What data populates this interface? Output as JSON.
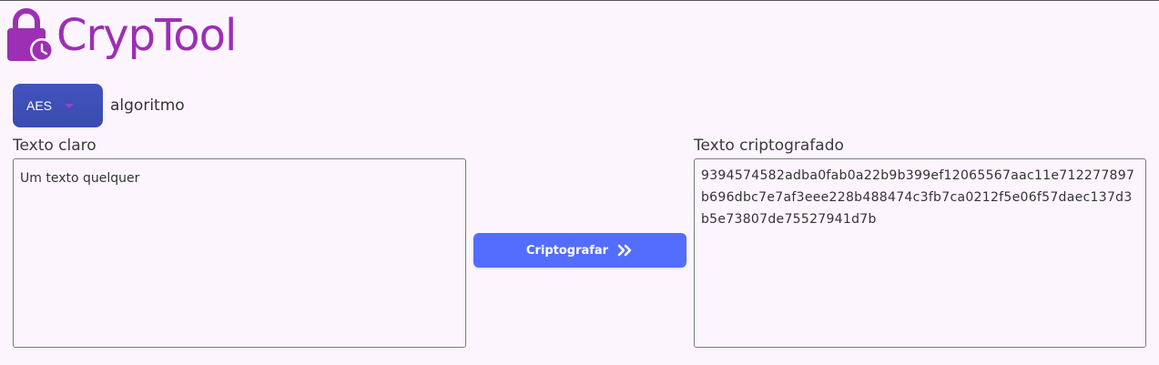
{
  "app": {
    "title": "CrypTool",
    "logo_icon": "lock-clock-icon",
    "brand_color": "#9c2fb4"
  },
  "algorithm": {
    "selected": "AES",
    "label": "algoritmo"
  },
  "plaintext": {
    "label": "Texto claro",
    "value": "Um texto quelquer"
  },
  "ciphertext": {
    "label": "Texto criptografado",
    "value": "9394574582adba0fab0a22b9b399ef12065567aac11e712277897b696dbc7e7af3eee228b488474c3fb7ca0212f5e06f57daec137d3b5e73807de75527941d7b"
  },
  "actions": {
    "encrypt_label": "Criptografar",
    "encrypt_icon": "double-chevron-right-icon",
    "button_color": "#536dfe"
  }
}
